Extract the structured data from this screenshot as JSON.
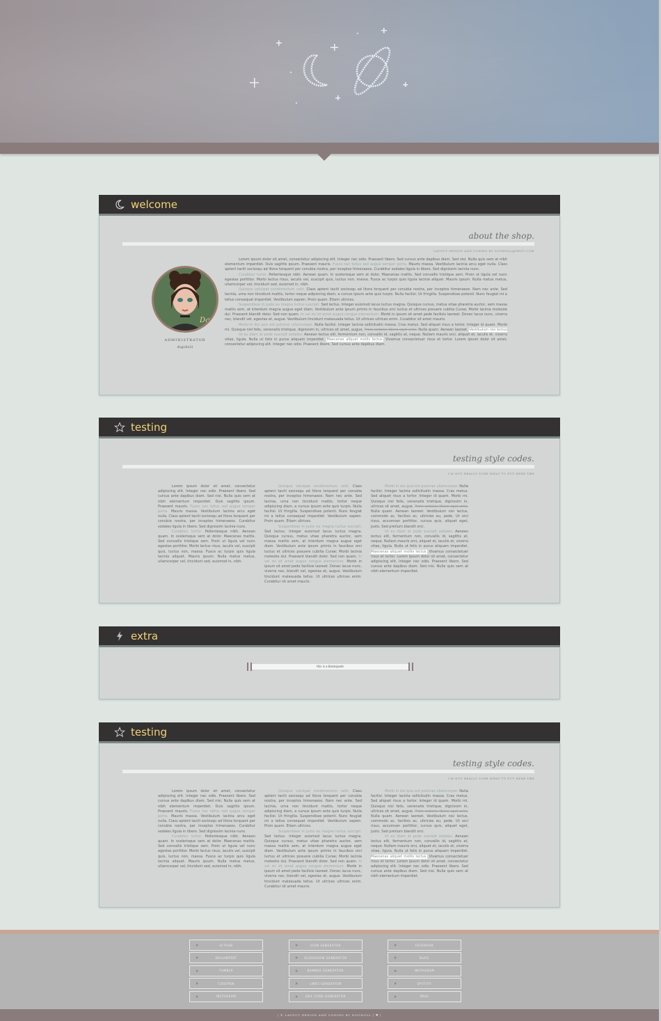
{
  "colors": {
    "accent_gold": "#f3d37a",
    "panel_head": "#333131",
    "mauve": "#8a7b7d",
    "footer_bg": "#b4b4b4",
    "page_bg": "#dfe6e2"
  },
  "panels": {
    "welcome": {
      "title": "welcome",
      "icon": "moon-icon",
      "section_title": "about the shop.",
      "section_sub": "LAYOUT DESIGN AND CODING BY DIGIDOLL@IMVU.COM",
      "admin_role": "ADMINISTRATOR",
      "admin_name": "digidoll",
      "p1a": "Lorem ipsum dolor sit amet, consectetur adipiscing elit. Integer nec odio. Praesent libero. Sed cursus ante dapibus diam. Sed nisi. Nulla quis sem at nibh elementum imperdiet. Duis sagittis ipsum. Praesent mauris.",
      "p1link": "Fusce nec tellus sed augue semper porta.",
      "p1b": "Mauris massa. Vestibulum lacinia arcu eget nulla. Class aptent taciti sociosqu ad litora torquent per conubia nostra, per inceptos himenaeos. Curabitur sodales ligula in libero. Sed dignissim lacinia nunc.",
      "p2link": "Curabitur tortor.",
      "p2": "Pellentesque nibh. Aenean quam. In scelerisque sem at dolor. Maecenas mattis. Sed convallis tristique sem. Proin ut ligula vel nunc egestas porttitor. Morbi lectus risus, iaculis vel, suscipit quis, luctus non, massa. Fusce ac turpis quis ligula lacinia aliquet. Mauris ipsum. Nulla metus metus, ullamcorper vel, tincidunt sed, euismod in, nibh.",
      "p3link": "Quisque volutpat condimentum velit.",
      "p3": "Class aptent taciti sociosqu ad litora torquent per conubia nostra, per inceptos himenaeos. Nam nec ante. Sed lacinia, urna non tincidunt mattis, tortor neque adipiscing diam, a cursus ipsum ante quis turpis. Nulla facilisi. Ut fringilla. Suspendisse potenti. Nunc feugiat mi a tellus consequat imperdiet. Vestibulum sapien. Proin quam. Etiam ultrices.",
      "p4link": "Suspendisse in justo eu magna luctus suscipit.",
      "p4a": "Sed lectus. Integer euismod lacus luctus magna. Quisque cursus, metus vitae pharetra auctor, sem massa mattis sem, at interdum magna augue eget diam. Vestibulum ante ipsum primis in faucibus orci luctus et ultrices posuere cubilia Curae; Morbi lacinia molestie dui. Praesent blandit dolor. Sed non quam.",
      "p4link2": "In vel mi sit amet augue congue elementum.",
      "p4b": "Morbi in ipsum sit amet pede facilisis laoreet. Donec lacus nunc, viverra nec, blandit vel, egestas et, augue. Vestibulum tincidunt malesuada tellus. Ut ultrices ultrices enim. Curabitur sit amet mauris.",
      "p5link": "Morbi in dui quis est pulvinar ullamcorper.",
      "p5a": "Nulla facilisi. Integer lacinia sollicitudin massa. Cras metus. Sed aliquet risus a tortor. Integer id quam. Morbi mi. Quisque nisl felis, venenatis tristique, dignissim in, ultrices sit amet, augue.",
      "p5strike": "Proin sodales libero eget ante.",
      "p5b": "Nulla quam. Aenean laoreet.",
      "p5mark": "Vestibulum nisi lectus",
      "p6link": "Ut eu diam at pede suscipit sodales.",
      "p6a": "Aenean lectus elit, fermentum non, convallis id, sagittis at, neque. Nullam mauris orci, aliquet et, iaculis et, viverra vitae, ligula. Nulla ut felis in purus aliquam imperdiet.",
      "p6mark": "Maecenas aliquet mollis lectus.",
      "p6b": "Vivamus consectetuer risus et tortor. Lorem ipsum dolor sit amet, consectetur adipiscing elit. Integer nec odio. Praesent libero. Sed cursus ante dapibus diam."
    },
    "testing1": {
      "title": "testing",
      "icon": "star-icon",
      "section_title": "testing style codes.",
      "section_sub": "I'M NOT REALLY SURE WHAT TO PUT HERE TBH",
      "col1a": "Lorem ipsum dolor sit amet, consectetur adipiscing elit. Integer nec odio. Praesent libero. Sed cursus ante dapibus diam. Sed nisi. Nulla quis sem at nibh elementum imperdiet. Duis sagittis ipsum. Praesent mauris.",
      "col1link": "Fusce nec tellus sed augue semper porta.",
      "col1b": "Mauris massa. Vestibulum lacinia arcu eget nulla. Class aptent taciti sociosqu ad litora torquent per conubia nostra, per inceptos himenaeos. Curabitur sodales ligula in libero. Sed dignissim lacinia nunc.",
      "col1link2": "Curabitur tortor.",
      "col1c": "Pellentesque nibh. Aenean quam. In scelerisque sem at dolor. Maecenas mattis. Sed convallis tristique sem. Proin ut ligula vel nunc egestas porttitor. Morbi lectus risus, iaculis vel, suscipit quis, luctus non, massa. Fusce ac turpis quis ligula lacinia aliquet. Mauris ipsum. Nulla metus metus, ullamcorper vel, tincidunt sed, euismod in, nibh.",
      "col2link": "Quisque volutpat condimentum velit.",
      "col2a": "Class aptent taciti sociosqu ad litora torquent per conubia nostra, per inceptos himenaeos. Nam nec ante. Sed lacinia, urna non tincidunt mattis, tortor neque adipiscing diam, a cursus ipsum ante quis turpis. Nulla facilisi. Ut fringilla. Suspendisse potenti. Nunc feugiat mi a tellus consequat imperdiet. Vestibulum sapien. Proin quam. Etiam ultrices.",
      "col2link2": "Suspendisse in justo eu magna luctus suscipit.",
      "col2b": "Sed lectus. Integer euismod lacus luctus magna. Quisque cursus, metus vitae pharetra auctor, sem massa mattis sem, at interdum magna augue eget diam. Vestibulum ante ipsum primis in faucibus orci luctus et ultrices posuere cubilia Curae; Morbi lacinia molestie dui. Praesent blandit dolor. Sed non quam.",
      "col2link3": "In vel mi sit amet augue congue elementum.",
      "col2c": "Morbi in ipsum sit amet pede facilisis laoreet. Donec lacus nunc, viverra nec, blandit vel, egestas et, augue. Vestibulum tincidunt malesuada tellus. Ut ultrices ultrices enim. Curabitur sit amet mauris.",
      "col3link": "Morbi in dui quis est pulvinar ullamcorper.",
      "col3a": "Nulla facilisi. Integer lacinia sollicitudin massa. Cras metus. Sed aliquet risus a tortor. Integer id quam. Morbi mi. Quisque nisl felis, venenatis tristique, dignissim in, ultrices sit amet, augue.",
      "col3strike": "Proin sodales libero eget ante.",
      "col3b": "Nulla quam. Aenean laoreet. Vestibulum nisi lectus, commodo ac, facilisis ac, ultricies eu, pede. Ut orci risus, accumsan porttitor, cursus quis, aliquet eget, justo. Sed pretium blandit orci.",
      "col3link2": "Ut eu diam at pede suscipit sodales.",
      "col3c": "Aenean lectus elit, fermentum non, convallis id, sagittis at, neque. Nullam mauris orci, aliquet et, iaculis et, viverra vitae, ligula. Nulla ut felis in purus aliquam imperdiet.",
      "col3mark": "Maecenas aliquet mollis lectus.",
      "col3d": "Vivamus consectetuer risus et tortor. Lorem ipsum dolor sit amet, consectetur adipiscing elit. Integer nec odio. Praesent libero. Sed cursus ante dapibus diam. Sed nisi. Nulla quis sem at nibh elementum imperdiet."
    },
    "extra": {
      "title": "extra",
      "icon": "lightning-icon",
      "blockquote": "this is a blockquote"
    },
    "testing2": {
      "title": "testing",
      "icon": "star-icon",
      "section_title": "testing style codes.",
      "section_sub": "I'M NOT REALLY SURE WHAT TO PUT HERE TBH"
    }
  },
  "footer": {
    "col1": [
      "GITHUB",
      "DEVIANTART",
      "TUMBLR",
      "CODEPEN",
      "INSTAGRAM"
    ],
    "col2": [
      "ICON GENERATOR",
      "SLIDESHOW GENERATOR",
      "BANNER GENERATOR",
      "LINKS GENERATOR",
      "HEX CODE GENERATOR"
    ],
    "col3": [
      "FACEBOOK",
      "BLOG",
      "INSTAGRAM",
      "SPOTIFY",
      "IMVU"
    ],
    "credit": "| © LAYOUT DESIGN AND CODING BY DIGIDOLL | ♥ |"
  }
}
